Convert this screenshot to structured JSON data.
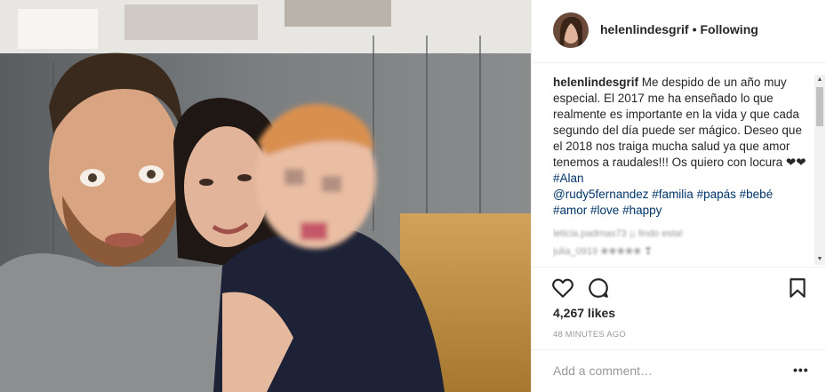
{
  "post": {
    "username": "helenlindesgrif",
    "separator": "•",
    "follow_status": "Following",
    "caption_user": "helenlindesgrif",
    "caption_text": " Me despido de un año muy especial. El 2017 me ha enseñado lo que realmente es importante en la vida y que cada segundo del día puede ser mágico. Deseo que el 2018 nos traiga mucha salud ya que amor tenemos a raudales!!! Os quiero con locura ❤❤",
    "tags": [
      "#Alan",
      "@rudy5fernandez",
      "#familia",
      "#papás",
      "#bebé",
      "#amor",
      "#love",
      "#happy"
    ],
    "blurred_comments": [
      "leticia.padmas73 ¡¡ lindo esta!",
      "julia_0919 ❀❀❀❀❀ ❣"
    ],
    "likes": "4,267 likes",
    "time": "48 MINUTES AGO",
    "comment_placeholder": "Add a comment…",
    "more_label": "•••"
  },
  "icons": {
    "like": "heart-outline-icon",
    "comment": "speech-bubble-icon",
    "save": "bookmark-icon"
  },
  "colors": {
    "text": "#262626",
    "link": "#003569",
    "muted": "#999999",
    "border": "#efefef"
  }
}
